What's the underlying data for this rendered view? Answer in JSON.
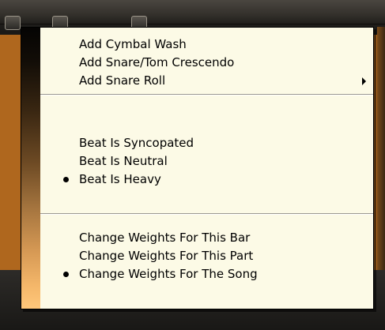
{
  "menu": {
    "groups": [
      {
        "items": [
          {
            "label": "Add Cymbal Wash",
            "selected": false,
            "has_submenu": false
          },
          {
            "label": "Add Snare/Tom Crescendo",
            "selected": false,
            "has_submenu": false
          },
          {
            "label": "Add Snare Roll",
            "selected": false,
            "has_submenu": true
          }
        ]
      },
      {
        "items": [
          {
            "label": "Beat Is Syncopated",
            "selected": false,
            "has_submenu": false
          },
          {
            "label": "Beat Is Neutral",
            "selected": false,
            "has_submenu": false
          },
          {
            "label": "Beat Is Heavy",
            "selected": true,
            "has_submenu": false
          }
        ]
      },
      {
        "items": [
          {
            "label": "Change Weights For This Bar",
            "selected": false,
            "has_submenu": false
          },
          {
            "label": "Change Weights For This Part",
            "selected": false,
            "has_submenu": false
          },
          {
            "label": "Change Weights For The Song",
            "selected": true,
            "has_submenu": false
          }
        ]
      }
    ]
  },
  "icons": {
    "selected_bullet": "bullet-icon",
    "submenu_arrow": "submenu-arrow-icon"
  },
  "colors": {
    "menu_background": "#fcfae6",
    "sidebar_dark": "#050403",
    "sidebar_light": "#ffc77a",
    "app_accent": "#c9751f"
  }
}
